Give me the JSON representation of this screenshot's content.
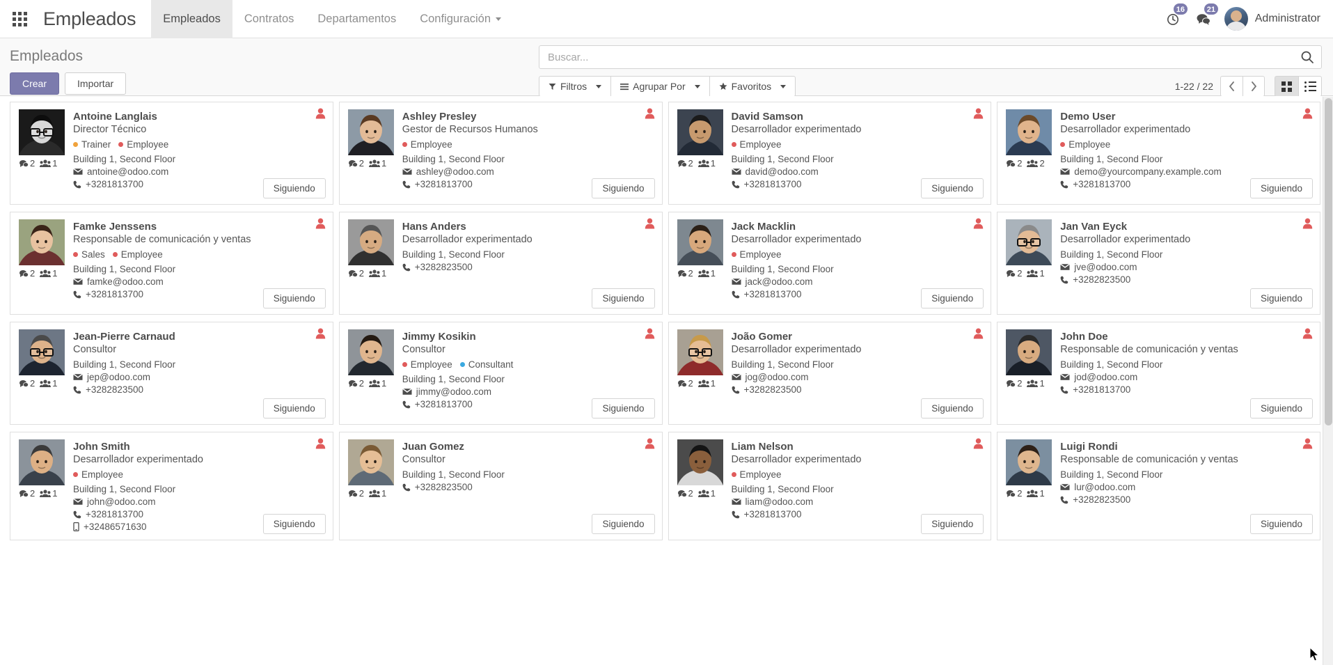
{
  "navbar": {
    "apps_icon": "grid-apps-icon",
    "brand": "Empleados",
    "menu": [
      {
        "label": "Empleados",
        "active": true
      },
      {
        "label": "Contratos",
        "active": false
      },
      {
        "label": "Departamentos",
        "active": false
      },
      {
        "label": "Configuración",
        "active": false,
        "has_caret": true
      }
    ],
    "activities_badge": "16",
    "messages_badge": "21",
    "activities_icon": "clock-icon",
    "messages_icon": "chat-icon",
    "username": "Administrator"
  },
  "control_panel": {
    "page_title": "Empleados",
    "create_label": "Crear",
    "import_label": "Importar",
    "search_placeholder": "Buscar...",
    "search_value": "",
    "search_icon": "search-icon",
    "filters_label": "Filtros",
    "filters_icon": "funnel-icon",
    "groupby_label": "Agrupar Por",
    "groupby_icon": "hamburger-icon",
    "favorites_label": "Favoritos",
    "favorites_icon": "star-icon",
    "pager": "1-22 / 22",
    "prev_icon": "chevron-left-icon",
    "next_icon": "chevron-right-icon",
    "kanban_view_icon": "kanban-view-icon",
    "list_view_icon": "list-view-icon",
    "active_view": "kanban"
  },
  "kanban": {
    "follow_label": "Siguiendo",
    "flag_icon": "user-red-icon",
    "comment_icon": "comment-icon",
    "followers_icon": "users-icon",
    "email_icon": "envelope-icon",
    "phone_icon": "phone-icon",
    "mobile_icon": "mobile-icon",
    "tag_colors": {
      "Trainer": "#f0a33c",
      "Employee": "#e05b5b",
      "Sales": "#e05b5b",
      "Consultant": "#3ba9e0"
    },
    "cards": [
      {
        "name": "Antoine Langlais",
        "job": "Director Técnico",
        "tags": [
          {
            "label": "Trainer",
            "color": "#f0a33c"
          },
          {
            "label": "Employee",
            "color": "#e05b5b"
          }
        ],
        "location": "Building 1, Second Floor",
        "email": "antoine@odoo.com",
        "phone": "+3281813700",
        "mobile": "",
        "comments": "2",
        "followers": "1",
        "photo": "man-glasses-bw"
      },
      {
        "name": "Ashley Presley",
        "job": "Gestor de Recursos Humanos",
        "tags": [
          {
            "label": "Employee",
            "color": "#e05b5b"
          }
        ],
        "location": "Building 1, Second Floor",
        "email": "ashley@odoo.com",
        "phone": "+3281813700",
        "mobile": "",
        "comments": "2",
        "followers": "1",
        "photo": "woman-office"
      },
      {
        "name": "David Samson",
        "job": "Desarrollador experimentado",
        "tags": [
          {
            "label": "Employee",
            "color": "#e05b5b"
          }
        ],
        "location": "Building 1, Second Floor",
        "email": "david@odoo.com",
        "phone": "+3281813700",
        "mobile": "",
        "comments": "2",
        "followers": "1",
        "photo": "man-dark"
      },
      {
        "name": "Demo User",
        "job": "Desarrollador experimentado",
        "tags": [
          {
            "label": "Employee",
            "color": "#e05b5b"
          }
        ],
        "location": "Building 1, Second Floor",
        "email": "demo@yourcompany.example.com",
        "phone": "+3281813700",
        "mobile": "",
        "comments": "2",
        "followers": "2",
        "photo": "man-suit-blue"
      },
      {
        "name": "Famke Jenssens",
        "job": "Responsable de comunicación y ventas",
        "tags": [
          {
            "label": "Sales",
            "color": "#e05b5b"
          },
          {
            "label": "Employee",
            "color": "#e05b5b"
          }
        ],
        "location": "Building 1, Second Floor",
        "email": "famke@odoo.com",
        "phone": "+3281813700",
        "mobile": "",
        "comments": "2",
        "followers": "1",
        "photo": "woman-brunette"
      },
      {
        "name": "Hans Anders",
        "job": "Desarrollador experimentado",
        "tags": [],
        "location": "Building 1, Second Floor",
        "email": "",
        "phone": "+3282823500",
        "mobile": "",
        "comments": "2",
        "followers": "1",
        "photo": "man-bald"
      },
      {
        "name": "Jack Macklin",
        "job": "Desarrollador experimentado",
        "tags": [
          {
            "label": "Employee",
            "color": "#e05b5b"
          }
        ],
        "location": "Building 1, Second Floor",
        "email": "jack@odoo.com",
        "phone": "+3281813700",
        "mobile": "",
        "comments": "2",
        "followers": "1",
        "photo": "man-beard"
      },
      {
        "name": "Jan Van Eyck",
        "job": "Desarrollador experimentado",
        "tags": [],
        "location": "Building 1, Second Floor",
        "email": "jve@odoo.com",
        "phone": "+3282823500",
        "mobile": "",
        "comments": "2",
        "followers": "1",
        "photo": "man-glasses-gray"
      },
      {
        "name": "Jean-Pierre Carnaud",
        "job": "Consultor",
        "tags": [],
        "location": "Building 1, Second Floor",
        "email": "jep@odoo.com",
        "phone": "+3282823500",
        "mobile": "",
        "comments": "2",
        "followers": "1",
        "photo": "man-suit-dark"
      },
      {
        "name": "Jimmy Kosikin",
        "job": "Consultor",
        "tags": [
          {
            "label": "Employee",
            "color": "#e05b5b"
          },
          {
            "label": "Consultant",
            "color": "#3ba9e0"
          }
        ],
        "location": "Building 1, Second Floor",
        "email": "jimmy@odoo.com",
        "phone": "+3281813700",
        "mobile": "",
        "comments": "2",
        "followers": "1",
        "photo": "man-young"
      },
      {
        "name": "João Gomer",
        "job": "Desarrollador experimentado",
        "tags": [],
        "location": "Building 1, Second Floor",
        "email": "jog@odoo.com",
        "phone": "+3282823500",
        "mobile": "",
        "comments": "2",
        "followers": "1",
        "photo": "man-red-shirt"
      },
      {
        "name": "John Doe",
        "job": "Responsable de comunicación y ventas",
        "tags": [],
        "location": "Building 1, Second Floor",
        "email": "jod@odoo.com",
        "phone": "+3281813700",
        "mobile": "",
        "comments": "2",
        "followers": "1",
        "photo": "man-dark-suit"
      },
      {
        "name": "John Smith",
        "job": "Desarrollador experimentado",
        "tags": [
          {
            "label": "Employee",
            "color": "#e05b5b"
          }
        ],
        "location": "Building 1, Second Floor",
        "email": "john@odoo.com",
        "phone": "+3281813700",
        "mobile": "+32486571630",
        "comments": "2",
        "followers": "1",
        "photo": "man-gray-suit"
      },
      {
        "name": "Juan Gomez",
        "job": "Consultor",
        "tags": [],
        "location": "Building 1, Second Floor",
        "email": "",
        "phone": "+3282823500",
        "mobile": "",
        "comments": "2",
        "followers": "1",
        "photo": "man-casual"
      },
      {
        "name": "Liam Nelson",
        "job": "Desarrollador experimentado",
        "tags": [
          {
            "label": "Employee",
            "color": "#e05b5b"
          }
        ],
        "location": "Building 1, Second Floor",
        "email": "liam@odoo.com",
        "phone": "+3281813700",
        "mobile": "",
        "comments": "2",
        "followers": "1",
        "photo": "man-chef"
      },
      {
        "name": "Luigi Rondi",
        "job": "Responsable de comunicación y ventas",
        "tags": [],
        "location": "Building 1, Second Floor",
        "email": "lur@odoo.com",
        "phone": "+3282823500",
        "mobile": "",
        "comments": "2",
        "followers": "1",
        "photo": "man-italian"
      }
    ]
  }
}
